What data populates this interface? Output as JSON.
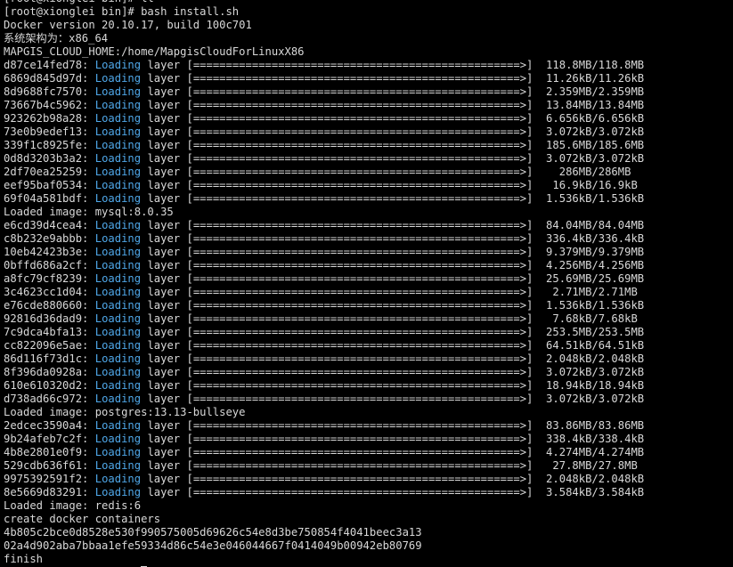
{
  "terminal": {
    "header_lines": [
      "[root@xionglei bin]# ll",
      "[root@xionglei bin]# bash install.sh",
      "Docker version 20.10.17, build 100c701",
      "系统架构为：x86_64",
      "MAPGIS_CLOUD_HOME:/home/MapgisCloudForLinuxX86"
    ],
    "layer_label": "Loading",
    "layer_word": "layer",
    "progress_bar": "[==================================================>]",
    "groups": [
      {
        "layers": [
          {
            "id": "d87ce14fed78:",
            "size": " 118.8MB/118.8MB"
          },
          {
            "id": "6869d845d97d:",
            "size": " 11.26kB/11.26kB"
          },
          {
            "id": "8d9688fc7570:",
            "size": " 2.359MB/2.359MB"
          },
          {
            "id": "73667b4c5962:",
            "size": " 13.84MB/13.84MB"
          },
          {
            "id": "923262b98a28:",
            "size": " 6.656kB/6.656kB"
          },
          {
            "id": "73e0b9edef13:",
            "size": " 3.072kB/3.072kB"
          },
          {
            "id": "339f1c8925fe:",
            "size": " 185.6MB/185.6MB"
          },
          {
            "id": "0d8d3203b3a2:",
            "size": " 3.072kB/3.072kB"
          },
          {
            "id": "2df70ea25259:",
            "size": "   286MB/286MB"
          },
          {
            "id": "eef95baf0534:",
            "size": "  16.9kB/16.9kB"
          },
          {
            "id": "69f04a581bdf:",
            "size": " 1.536kB/1.536kB"
          }
        ],
        "loaded": "Loaded image: mysql:8.0.35"
      },
      {
        "layers": [
          {
            "id": "e6cd39d4cea4:",
            "size": " 84.04MB/84.04MB"
          },
          {
            "id": "c8b232e9abbb:",
            "size": " 336.4kB/336.4kB"
          },
          {
            "id": "10eb42423b3e:",
            "size": " 9.379MB/9.379MB"
          },
          {
            "id": "0bffd686a2cf:",
            "size": " 4.256MB/4.256MB"
          },
          {
            "id": "a8fc79cf8239:",
            "size": " 25.69MB/25.69MB"
          },
          {
            "id": "3c4623cc1d04:",
            "size": "  2.71MB/2.71MB"
          },
          {
            "id": "e76cde880660:",
            "size": " 1.536kB/1.536kB"
          },
          {
            "id": "92816d36dad9:",
            "size": "  7.68kB/7.68kB"
          },
          {
            "id": "7c9dca4bfa13:",
            "size": " 253.5MB/253.5MB"
          },
          {
            "id": "cc822096e5ae:",
            "size": " 64.51kB/64.51kB"
          },
          {
            "id": "86d116f73d1c:",
            "size": " 2.048kB/2.048kB"
          },
          {
            "id": "8f396da0928a:",
            "size": " 3.072kB/3.072kB"
          },
          {
            "id": "610e610320d2:",
            "size": " 18.94kB/18.94kB"
          },
          {
            "id": "d738ad66c972:",
            "size": " 3.072kB/3.072kB"
          }
        ],
        "loaded": "Loaded image: postgres:13.13-bullseye"
      },
      {
        "layers": [
          {
            "id": "2edcec3590a4:",
            "size": " 83.86MB/83.86MB"
          },
          {
            "id": "9b24afeb7c2f:",
            "size": " 338.4kB/338.4kB"
          },
          {
            "id": "4b8e2801e0f9:",
            "size": " 4.274MB/4.274MB"
          },
          {
            "id": "529cdb636f61:",
            "size": "  27.8MB/27.8MB"
          },
          {
            "id": "9975392591f2:",
            "size": " 2.048kB/2.048kB"
          },
          {
            "id": "8e5669d83291:",
            "size": " 3.584kB/3.584kB"
          }
        ],
        "loaded": "Loaded image: redis:6"
      }
    ],
    "footer_lines": [
      "create docker containers",
      "4b805c2bce0d8528e530f990575005d69626c54e8d3be750854f4041beec3a13",
      "02a4d902aba7bbaa1efe59334d86c54e3e046044667f0414049b00942eb80769",
      "finish"
    ],
    "prompt": "[root@xionglei bin]# "
  }
}
